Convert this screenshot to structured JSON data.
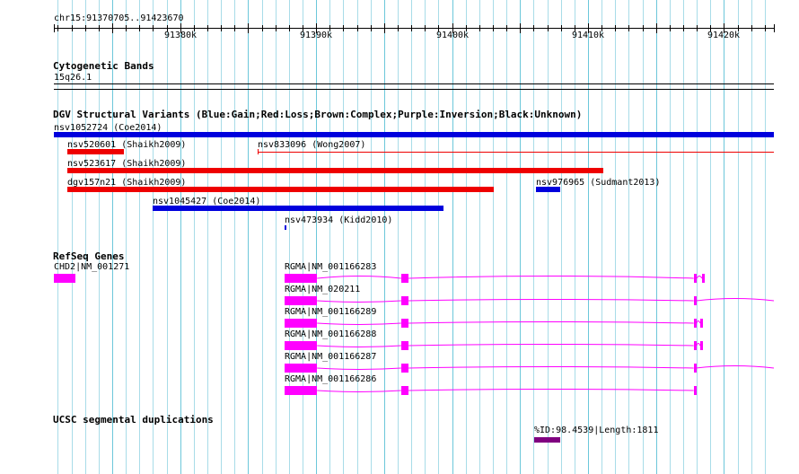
{
  "ruler": {
    "position_label": "chr15:91370705..91423670",
    "ticks": [
      {
        "pos": 91380000,
        "label": "91380k"
      },
      {
        "pos": 91390000,
        "label": "91390k"
      },
      {
        "pos": 91400000,
        "label": "91400k"
      },
      {
        "pos": 91410000,
        "label": "91410k"
      },
      {
        "pos": 91420000,
        "label": "91420k"
      }
    ]
  },
  "view": {
    "start": 91370705,
    "end": 91423670
  },
  "tracks": {
    "cytoband": {
      "title": "Cytogenetic Bands",
      "band_label": "15q26.1"
    },
    "dgv": {
      "title": "DGV Structural Variants (Blue:Gain;Red:Loss;Brown:Complex;Purple:Inversion;Black:Unknown)",
      "colors": {
        "gain": "#0000dd",
        "loss": "#ee0000"
      },
      "features": [
        {
          "id": "nsv1052724",
          "label": "nsv1052724 (Coe2014)",
          "type": "gain",
          "start": 91370705,
          "end": 91423670,
          "row": 0,
          "style": "thick"
        },
        {
          "id": "nsv520601",
          "label": "nsv520601 (Shaikh2009)",
          "type": "loss",
          "start": 91371670,
          "end": 91375870,
          "row": 1,
          "style": "thick"
        },
        {
          "id": "nsv833096",
          "label": "nsv833096 (Wong2007)",
          "type": "loss",
          "start": 91385680,
          "end": 91423670,
          "row": 1,
          "style": "thin"
        },
        {
          "id": "nsv523617",
          "label": "nsv523617 (Shaikh2009)",
          "type": "loss",
          "start": 91371670,
          "end": 91411150,
          "row": 2,
          "style": "thick"
        },
        {
          "id": "dgv157n21",
          "label": "dgv157n21 (Shaikh2009)",
          "type": "loss",
          "start": 91371670,
          "end": 91403080,
          "row": 3,
          "style": "thick"
        },
        {
          "id": "nsv976965",
          "label": "nsv976965 (Sudmant2013)",
          "type": "gain",
          "start": 91406170,
          "end": 91407920,
          "row": 3,
          "style": "thick"
        },
        {
          "id": "nsv1045427",
          "label": "nsv1045427 (Coe2014)",
          "type": "gain",
          "start": 91377970,
          "end": 91399390,
          "row": 4,
          "style": "thick"
        },
        {
          "id": "nsv473934",
          "label": "nsv473934 (Kidd2010)",
          "type": "gain",
          "start": 91387670,
          "end": 91387800,
          "row": 5,
          "style": "tiny"
        }
      ]
    },
    "refseq": {
      "title": "RefSeq Genes",
      "color": "#ff00ff",
      "genes": [
        {
          "label": "CHD2|NM_001271",
          "start": 91370705,
          "end": 91372300,
          "row": 0,
          "exons": [
            [
              91370705,
              91372300
            ]
          ]
        },
        {
          "label": "RGMA|NM_001166283",
          "start": 91387700,
          "end": 91418600,
          "row": 0,
          "exons": [
            [
              91387700,
              91390070
            ],
            [
              91396250,
              91396800
            ],
            [
              91417770,
              91418000
            ],
            [
              91418380,
              91418600
            ]
          ],
          "intron_style": "hat"
        },
        {
          "label": "RGMA|NM_020211",
          "start": 91387700,
          "end": 91423670,
          "row": 1,
          "exons": [
            [
              91387700,
              91390070
            ],
            [
              91396250,
              91396800
            ],
            [
              91417770,
              91417970
            ]
          ],
          "intron_style": "wave"
        },
        {
          "label": "RGMA|NM_001166289",
          "start": 91387700,
          "end": 91418400,
          "row": 2,
          "exons": [
            [
              91387700,
              91390070
            ],
            [
              91396250,
              91396800
            ],
            [
              91417770,
              91417970
            ],
            [
              91418250,
              91418400
            ]
          ],
          "intron_style": "wave"
        },
        {
          "label": "RGMA|NM_001166288",
          "start": 91387700,
          "end": 91418400,
          "row": 3,
          "exons": [
            [
              91387700,
              91390070
            ],
            [
              91396250,
              91396800
            ],
            [
              91417770,
              91417970
            ],
            [
              91418250,
              91418400
            ]
          ],
          "intron_style": "wave"
        },
        {
          "label": "RGMA|NM_001166287",
          "start": 91387700,
          "end": 91423670,
          "row": 4,
          "exons": [
            [
              91387700,
              91390070
            ],
            [
              91396250,
              91396800
            ],
            [
              91417770,
              91417930
            ]
          ],
          "intron_style": "wave"
        },
        {
          "label": "RGMA|NM_001166286",
          "start": 91387700,
          "end": 91417970,
          "row": 5,
          "exons": [
            [
              91387700,
              91390070
            ],
            [
              91396250,
              91396800
            ],
            [
              91417770,
              91417970
            ]
          ],
          "intron_style": "wave"
        }
      ]
    },
    "segdup": {
      "title": "UCSC segmental duplications",
      "color": "#800080",
      "features": [
        {
          "label": "%ID:98.4539|Length:1811",
          "start": 91406070,
          "end": 91407920
        }
      ]
    }
  }
}
